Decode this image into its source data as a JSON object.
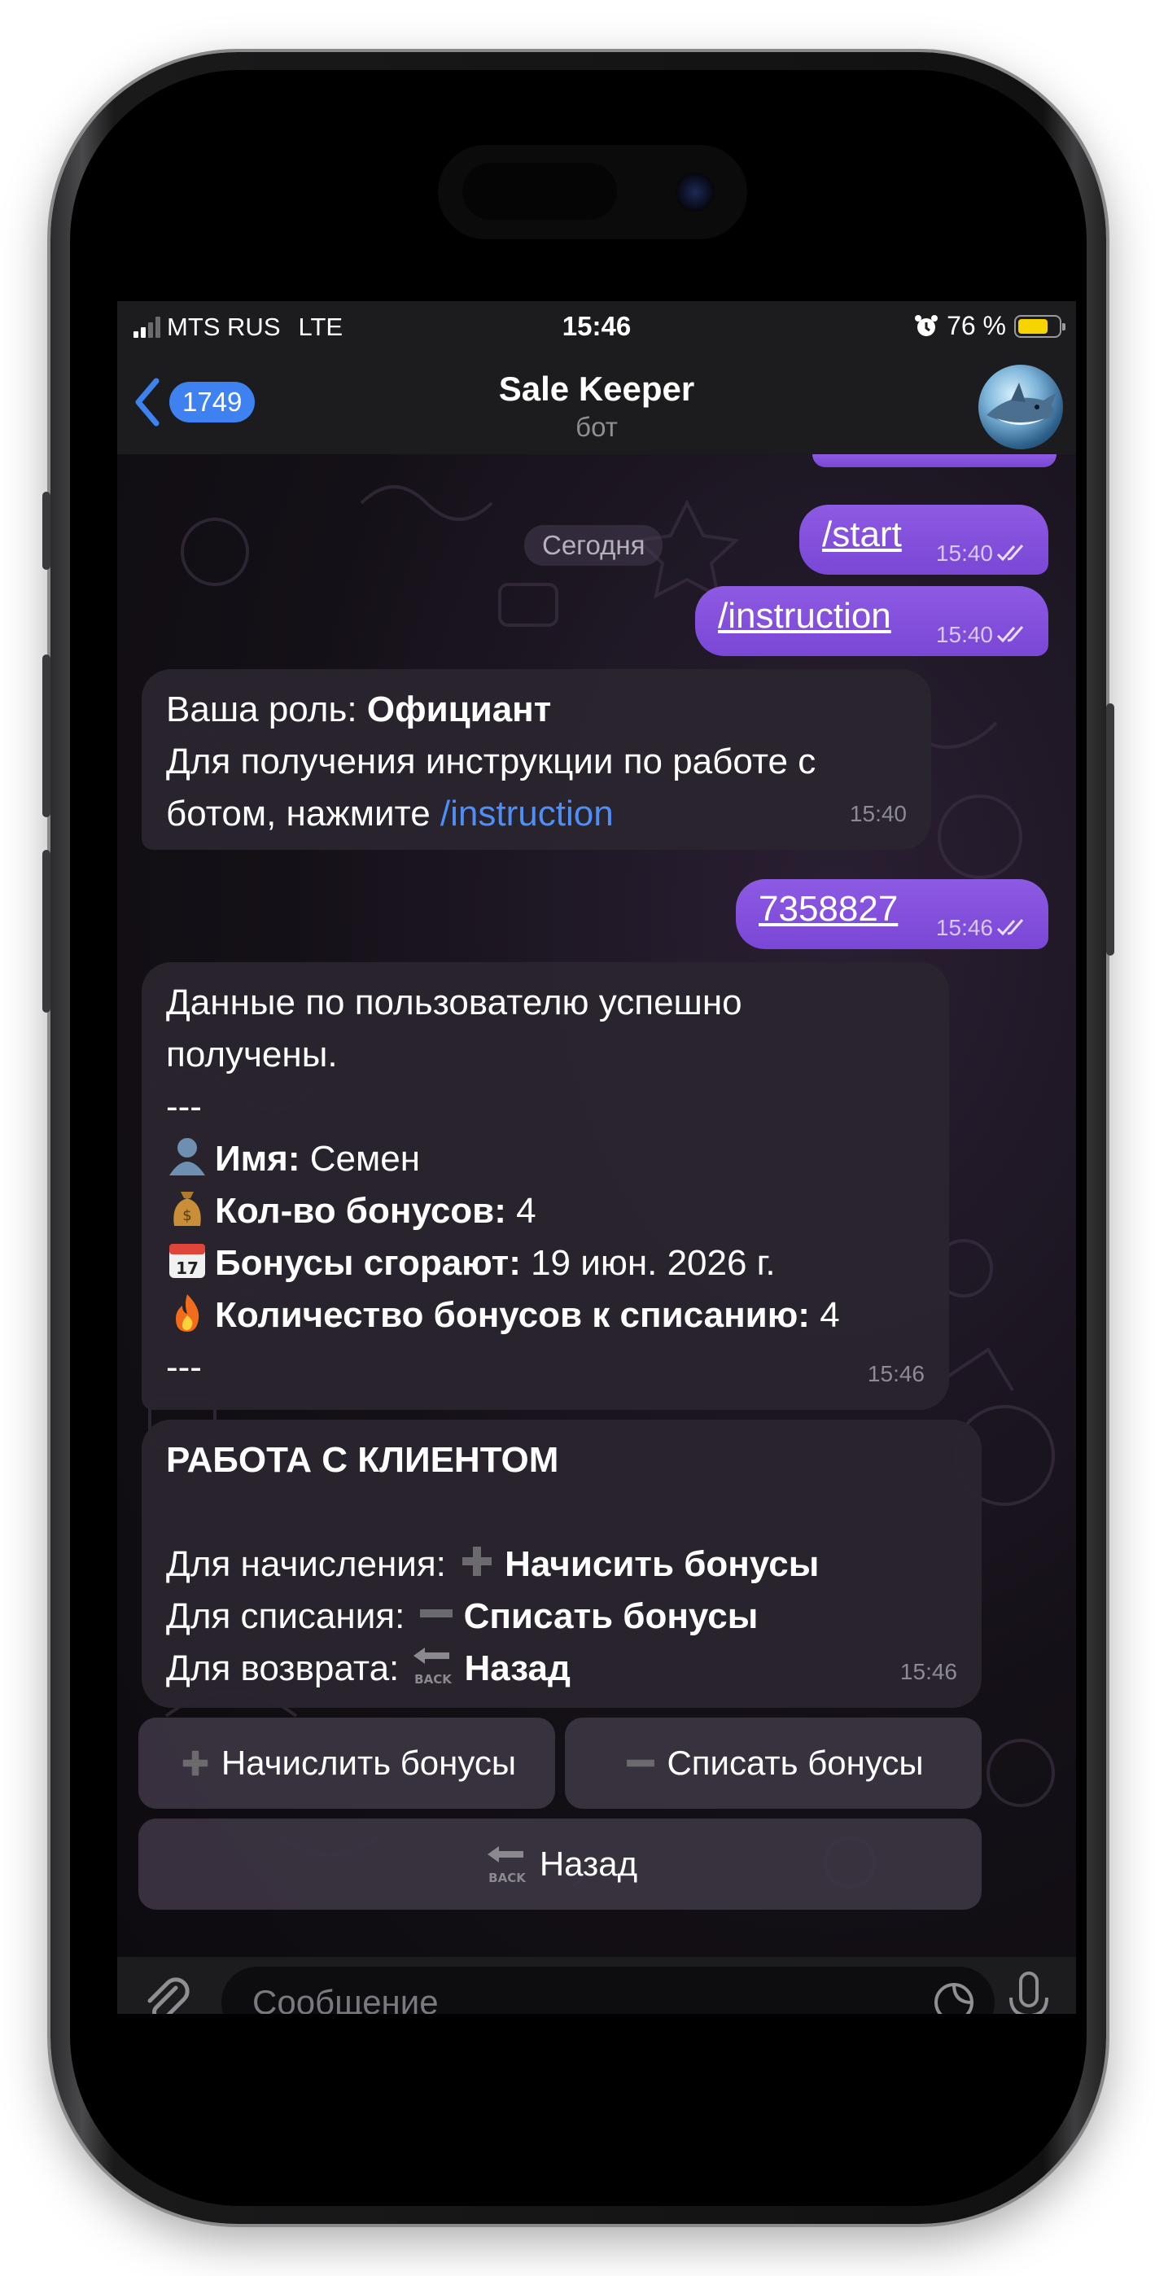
{
  "status_bar": {
    "carrier": "MTS RUS",
    "network": "LTE",
    "time": "15:46",
    "battery": "76 %",
    "battery_level": 0.76,
    "battery_color": "#f5d400"
  },
  "header": {
    "back_count": "1749",
    "title": "Sale Keeper",
    "subtitle": "бот",
    "accent": "#3d82f0"
  },
  "chat": {
    "day_separator": "Сегодня",
    "messages": [
      {
        "text": "/start",
        "time": "15:40"
      },
      {
        "text": "/instruction",
        "time": "15:40"
      },
      {
        "role_label": "Ваша роль: ",
        "role_value": "Официант",
        "line2": "Для получения инструкции по работе с",
        "line3": "ботом, нажмите ",
        "link": "/instruction",
        "time": "15:40"
      },
      {
        "text": "7358827",
        "time": "15:46"
      },
      {
        "line1": "Данные по пользователю успешно",
        "line2": "получены.",
        "sep": "---",
        "name_label": "Имя:",
        "name_value": " Семен",
        "bonus_label": "Кол-во бонусов:",
        "bonus_value": " 4",
        "expire_label": "Бонусы сгорают:",
        "expire_value": " 19 июн. 2026 г.",
        "spend_label": "Количество бонусов к списанию:",
        "spend_value": " 4",
        "sep2": "---",
        "time": "15:46"
      },
      {
        "heading": "РАБОТА С КЛИЕНТОМ",
        "accrue_label": "Для начисления: ",
        "accrue_action": "Начисить бонусы",
        "writeoff_label": "Для списания: ",
        "writeoff_action": "Списать бонусы",
        "return_label": "Для возврата: ",
        "return_action": "Назад",
        "time": "15:46"
      }
    ],
    "outgoing_color": "#8d5ae3",
    "link_color": "#4e8ef7"
  },
  "keyboard": {
    "accrue": "Начислить бонусы",
    "writeoff": "Списать бонусы",
    "back": "Назад",
    "back_icon_text": "BACK"
  },
  "composer": {
    "placeholder": "Сообщение"
  }
}
